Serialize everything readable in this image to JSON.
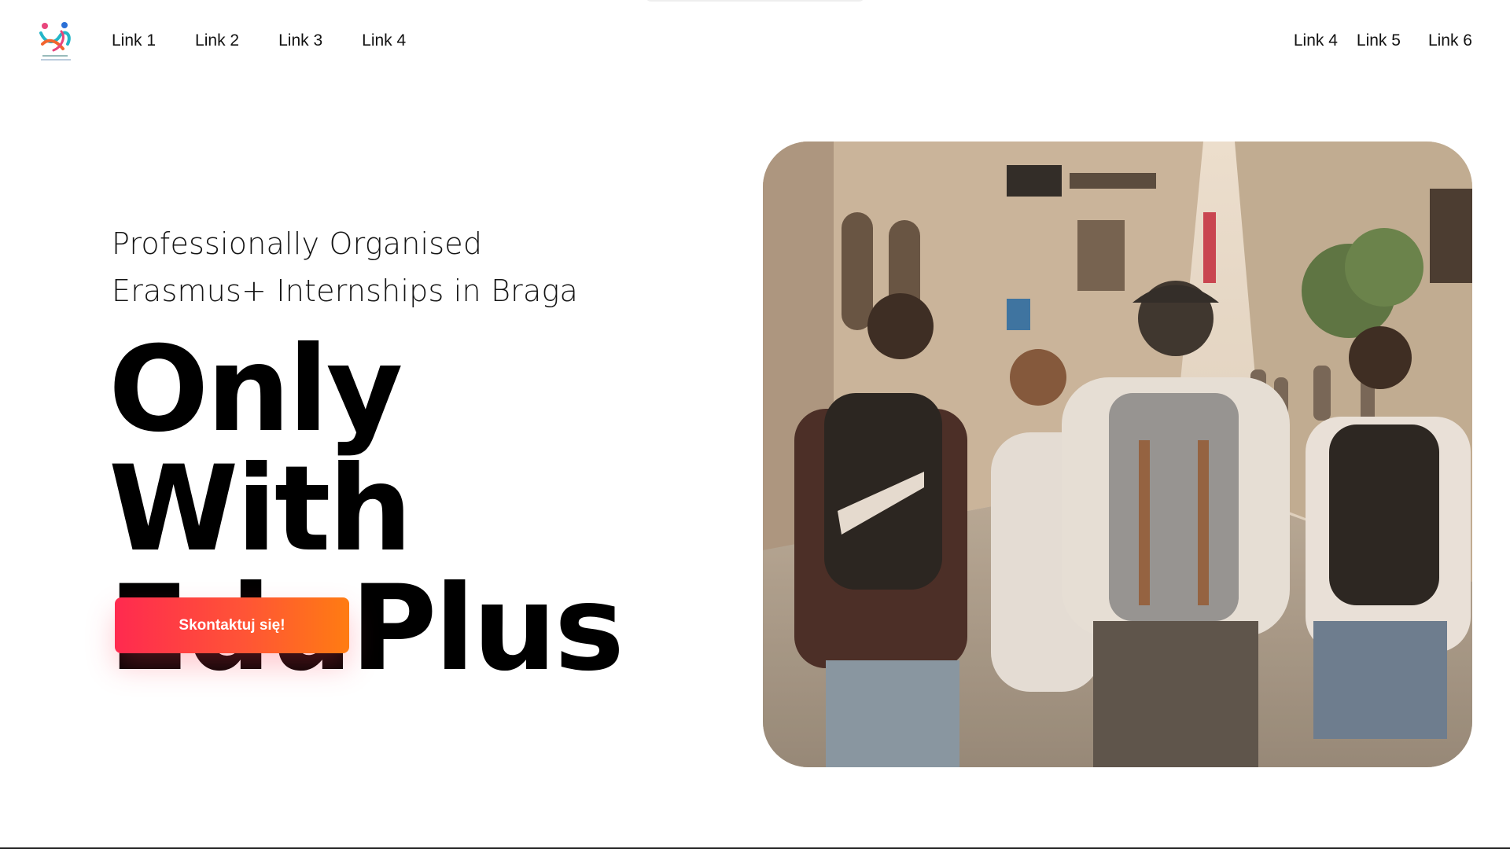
{
  "header": {
    "logo_icon": "eduplus-logo-icon",
    "nav_left": [
      {
        "label": "Link 1"
      },
      {
        "label": "Link 2"
      },
      {
        "label": "Link 3"
      },
      {
        "label": "Link 4"
      }
    ],
    "nav_right": [
      {
        "label": "Link 4"
      },
      {
        "label": "Link 5"
      },
      {
        "label": "Link 6"
      }
    ]
  },
  "hero": {
    "subtitle_line1": "Professionally Organised",
    "subtitle_line2": "Erasmus+ Internships in Braga",
    "headline_line1": "Only With",
    "headline_line2": "EduPlus",
    "cta_label": "Skontaktuj się!",
    "image_icon": "street-students-photo"
  },
  "colors": {
    "cta_gradient_start": "#ff2a4f",
    "cta_gradient_end": "#ff7c12",
    "text": "#111111",
    "background": "#ffffff"
  }
}
